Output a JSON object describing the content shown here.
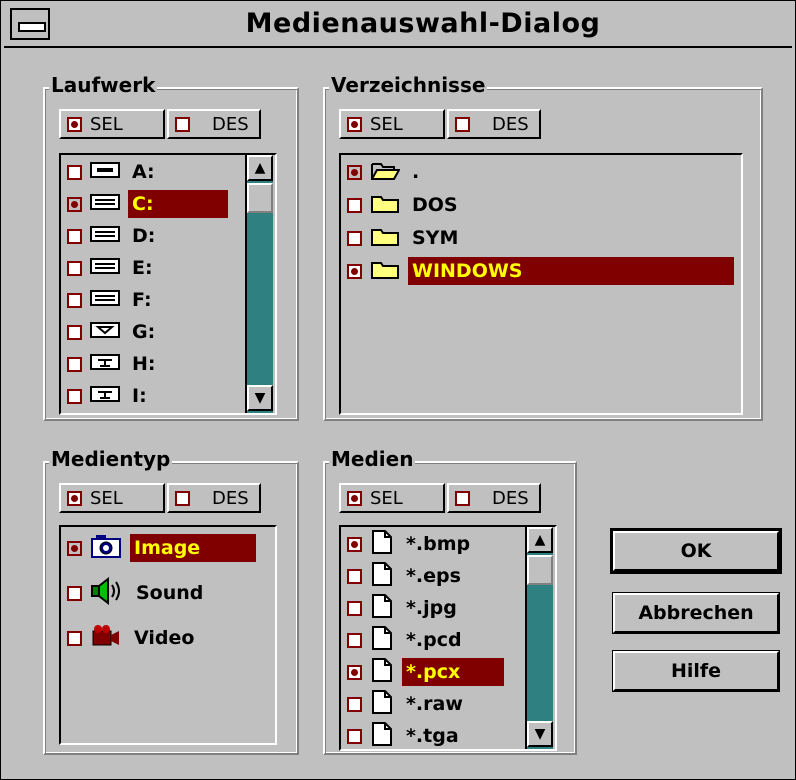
{
  "window": {
    "title": "Medienauswahl-Dialog"
  },
  "buttons": {
    "sel": "SEL",
    "des": "DES"
  },
  "drives": {
    "label": "Laufwerk",
    "items": [
      {
        "label": "A:",
        "checked": false,
        "icon": "floppy-drive-icon"
      },
      {
        "label": "C:",
        "checked": true,
        "icon": "hard-drive-icon",
        "highlighted": true
      },
      {
        "label": "D:",
        "checked": false,
        "icon": "hard-drive-icon"
      },
      {
        "label": "E:",
        "checked": false,
        "icon": "hard-drive-icon"
      },
      {
        "label": "F:",
        "checked": false,
        "icon": "hard-drive-icon"
      },
      {
        "label": "G:",
        "checked": false,
        "icon": "cdrom-drive-icon"
      },
      {
        "label": "H:",
        "checked": false,
        "icon": "network-drive-icon"
      },
      {
        "label": "I:",
        "checked": false,
        "icon": "network-drive-icon"
      }
    ]
  },
  "directories": {
    "label": "Verzeichnisse",
    "items": [
      {
        "label": ".",
        "checked": true,
        "icon": "open-folder-icon"
      },
      {
        "label": "DOS",
        "checked": false,
        "icon": "folder-icon"
      },
      {
        "label": "SYM",
        "checked": false,
        "icon": "folder-icon"
      },
      {
        "label": "WINDOWS",
        "checked": true,
        "icon": "folder-icon",
        "highlighted": true
      }
    ]
  },
  "mediatype": {
    "label": "Medientyp",
    "items": [
      {
        "label": "Image",
        "checked": true,
        "icon": "camera-icon",
        "highlighted": true
      },
      {
        "label": "Sound",
        "checked": false,
        "icon": "speaker-icon"
      },
      {
        "label": "Video",
        "checked": false,
        "icon": "video-camera-icon"
      }
    ]
  },
  "media": {
    "label": "Medien",
    "items": [
      {
        "label": "*.bmp",
        "checked": true
      },
      {
        "label": "*.eps",
        "checked": false
      },
      {
        "label": "*.jpg",
        "checked": false
      },
      {
        "label": "*.pcd",
        "checked": false
      },
      {
        "label": "*.pcx",
        "checked": true,
        "highlighted": true
      },
      {
        "label": "*.raw",
        "checked": false
      },
      {
        "label": "*.tga",
        "checked": false
      }
    ]
  },
  "actions": {
    "ok": "OK",
    "cancel": "Abbrechen",
    "help": "Hilfe"
  }
}
